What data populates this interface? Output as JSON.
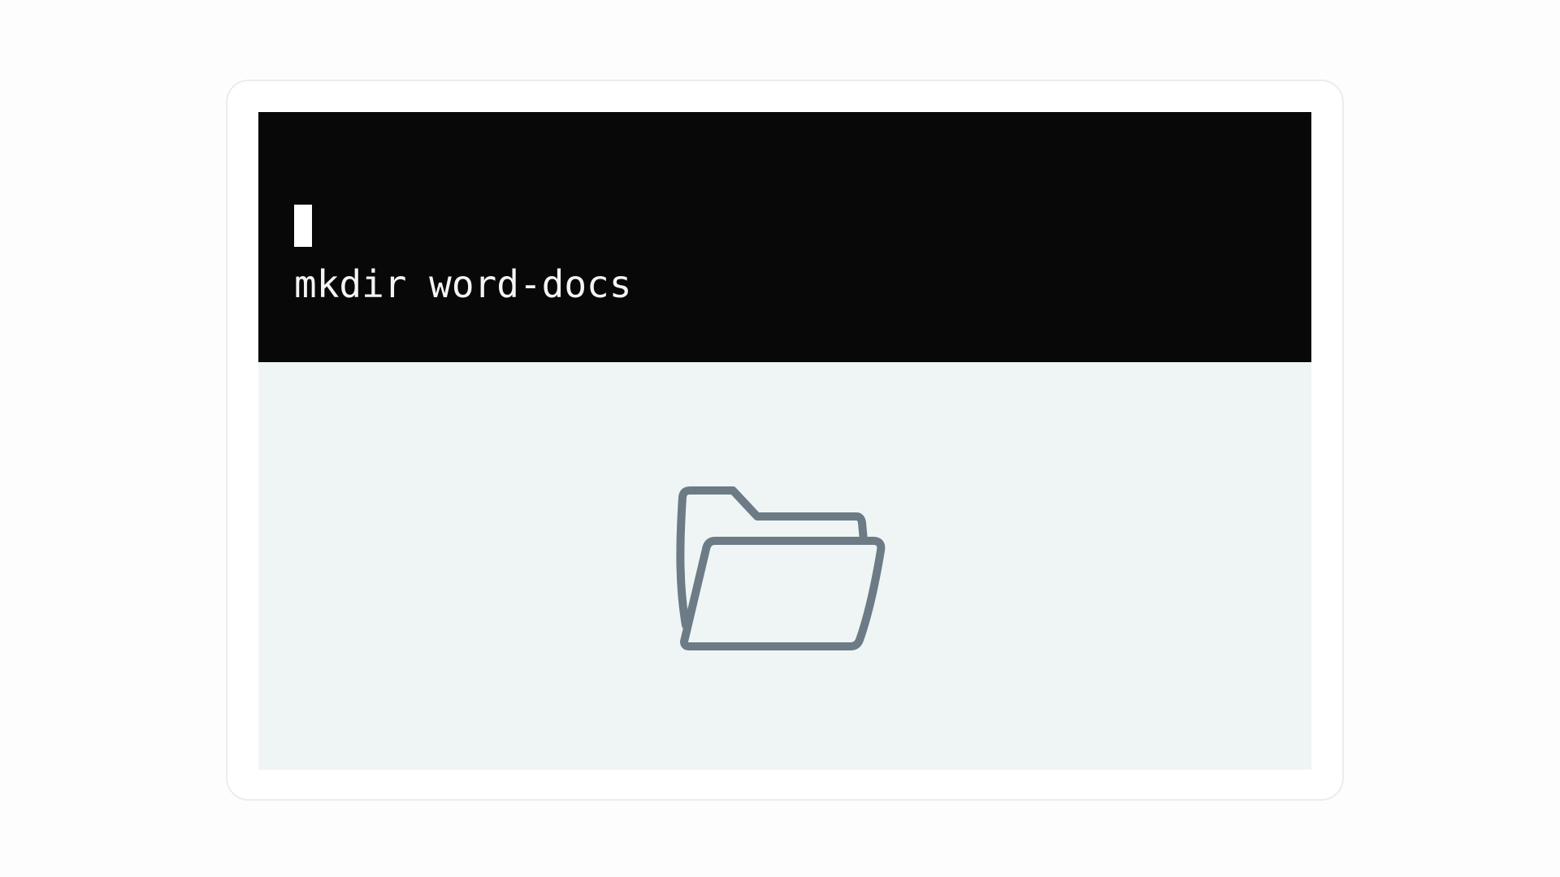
{
  "terminal": {
    "command": "mkdir word-docs"
  },
  "preview": {
    "icon": "folder-open-icon"
  },
  "colors": {
    "terminal_background": "#080808",
    "terminal_text": "#f4f4f4",
    "preview_background": "#eff5f5",
    "folder_stroke": "#6c7b86"
  }
}
